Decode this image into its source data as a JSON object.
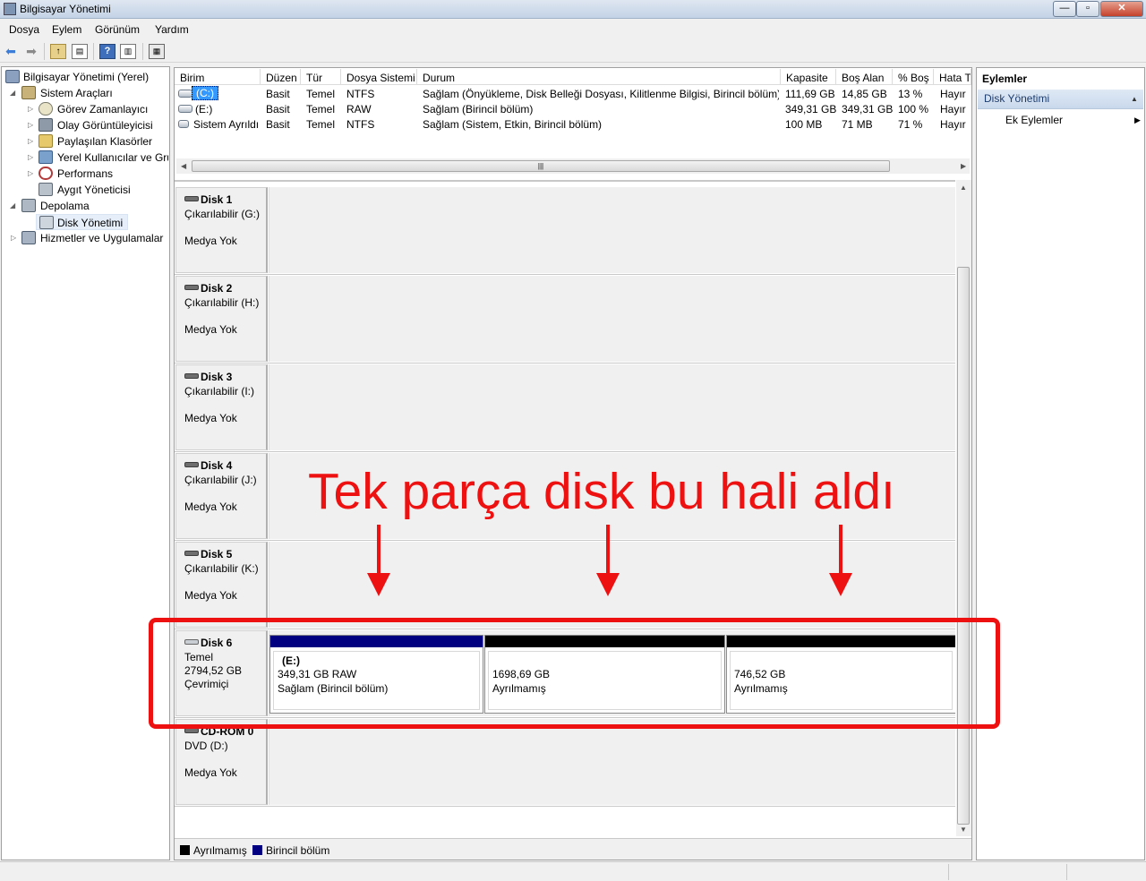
{
  "window": {
    "title": "Bilgisayar Yönetimi",
    "controls": {
      "minimize": "—",
      "maximize": "▫",
      "close": "✕"
    }
  },
  "menu": [
    "Dosya",
    "Eylem",
    "Görünüm",
    "Yardım"
  ],
  "toolbar": {
    "icons": [
      "back-arrow-icon",
      "forward-arrow-icon",
      "up-folder-icon",
      "show-tree-icon",
      "help-icon",
      "properties-icon",
      "export-icon"
    ]
  },
  "tree": {
    "root": "Bilgisayar Yönetimi (Yerel)",
    "system_tools": "Sistem Araçları",
    "task_scheduler": "Görev Zamanlayıcı",
    "event_viewer": "Olay Görüntüleyicisi",
    "shared_folders": "Paylaşılan Klasörler",
    "local_users": "Yerel Kullanıcılar ve Gru",
    "performance": "Performans",
    "device_manager": "Aygıt Yöneticisi",
    "storage": "Depolama",
    "disk_management": "Disk Yönetimi",
    "services": "Hizmetler ve Uygulamalar"
  },
  "volume_list": {
    "columns": [
      "Birim",
      "Düzen",
      "Tür",
      "Dosya Sistemi",
      "Durum",
      "Kapasite",
      "Boş Alan",
      "% Boş",
      "Hata T"
    ],
    "rows": [
      {
        "birim": "(C:)",
        "duzen": "Basit",
        "tur": "Temel",
        "fs": "NTFS",
        "durum": "Sağlam (Önyükleme, Disk Belleği Dosyası, Kilitlenme Bilgisi, Birincil bölüm)",
        "kapasite": "111,69 GB",
        "bos": "14,85 GB",
        "yuzde": "13 %",
        "hata": "Hayır"
      },
      {
        "birim": "(E:)",
        "duzen": "Basit",
        "tur": "Temel",
        "fs": "RAW",
        "durum": "Sağlam (Birincil bölüm)",
        "kapasite": "349,31 GB",
        "bos": "349,31 GB",
        "yuzde": "100 %",
        "hata": "Hayır"
      },
      {
        "birim": "Sistem Ayrıldı",
        "duzen": "Basit",
        "tur": "Temel",
        "fs": "NTFS",
        "durum": "Sağlam (Sistem, Etkin, Birincil bölüm)",
        "kapasite": "100 MB",
        "bos": "71 MB",
        "yuzde": "71 %",
        "hata": "Hayır"
      }
    ]
  },
  "disks": [
    {
      "name": "Disk 1",
      "line1": "Çıkarılabilir (G:)",
      "line2": "Medya Yok"
    },
    {
      "name": "Disk 2",
      "line1": "Çıkarılabilir (H:)",
      "line2": "Medya Yok"
    },
    {
      "name": "Disk 3",
      "line1": "Çıkarılabilir (I:)",
      "line2": "Medya Yok"
    },
    {
      "name": "Disk 4",
      "line1": "Çıkarılabilir (J:)",
      "line2": "Medya Yok"
    },
    {
      "name": "Disk 5",
      "line1": "Çıkarılabilir (K:)",
      "line2": "Medya Yok"
    }
  ],
  "disk6": {
    "name": "Disk 6",
    "type": "Temel",
    "size": "2794,52 GB",
    "status": "Çevrimiçi",
    "partitions": [
      {
        "label": "(E:)",
        "size": "349,31 GB RAW",
        "status": "Sağlam (Birincil bölüm)",
        "color": "#000080"
      },
      {
        "size": "1698,69 GB",
        "status": "Ayrılmamış",
        "color": "#000000"
      },
      {
        "size": "746,52 GB",
        "status": "Ayrılmamış",
        "color": "#000000"
      }
    ]
  },
  "cdrom": {
    "name": "CD-ROM 0",
    "line1": "DVD (D:)",
    "line2": "Medya Yok"
  },
  "legend": [
    {
      "label": "Ayrılmamış",
      "color": "#000000"
    },
    {
      "label": "Birincil bölüm",
      "color": "#000080"
    }
  ],
  "actions": {
    "title": "Eylemler",
    "section": "Disk Yönetimi",
    "item": "Ek Eylemler"
  },
  "annotation": {
    "text": "Tek parça disk bu hali aldı",
    "color": "#ee1111"
  }
}
